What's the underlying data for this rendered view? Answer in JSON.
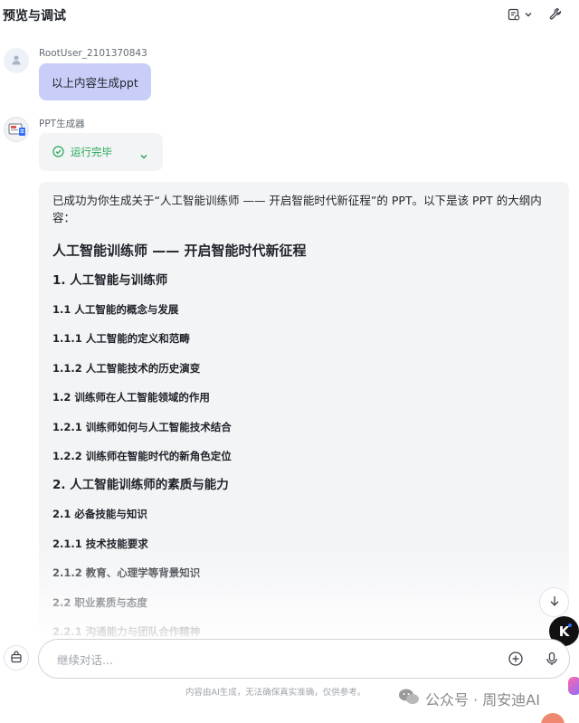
{
  "header": {
    "title": "预览与调试"
  },
  "user_message": {
    "sender": "RootUser_2101370843",
    "text": "以上内容生成ppt"
  },
  "bot_message": {
    "sender": "PPT生成器",
    "run_status": "运行完毕",
    "intro": "已成功为你生成关于“人工智能训练师 —— 开启智能时代新征程”的 PPT。以下是该 PPT 的大纲内容：",
    "outline_title": "人工智能训练师 —— 开启智能时代新征程",
    "outline": [
      {
        "level": 2,
        "text": "1. 人工智能与训练师"
      },
      {
        "level": 3,
        "text": "1.1 人工智能的概念与发展"
      },
      {
        "level": 3,
        "text": "1.1.1 人工智能的定义和范畴"
      },
      {
        "level": 3,
        "text": "1.1.2 人工智能技术的历史演变"
      },
      {
        "level": 3,
        "text": "1.2 训练师在人工智能领域的作用"
      },
      {
        "level": 3,
        "text": "1.2.1 训练师如何与人工智能技术结合"
      },
      {
        "level": 3,
        "text": "1.2.2 训练师在智能时代的新角色定位"
      },
      {
        "level": 2,
        "text": "2. 人工智能训练师的素质与能力"
      },
      {
        "level": 3,
        "text": "2.1 必备技能与知识"
      },
      {
        "level": 3,
        "text": "2.1.1 技术技能要求"
      },
      {
        "level": 3,
        "text": "2.1.2 教育、心理学等背景知识"
      },
      {
        "level": 3,
        "text": "2.2 职业素质与态度"
      },
      {
        "level": 3,
        "text": "2.2.1 沟通能力与团队合作精神"
      }
    ]
  },
  "composer": {
    "placeholder": "继续对话..."
  },
  "footer": {
    "disclaimer": "内容由AI生成，无法确保真实准确，仅供参考。",
    "watermark": "公众号 · 周安迪AI",
    "k_logo": "K"
  },
  "colors": {
    "user_bubble": "#c9cef9",
    "success": "#22a855",
    "panel_bg": "#f3f4f6"
  },
  "icons": {
    "header": [
      "document-settings-icon",
      "chevron-down-icon",
      "wrench-icon"
    ],
    "composer": [
      "plugin-icon",
      "add-circle-icon",
      "microphone-icon"
    ],
    "other": [
      "user-avatar-icon",
      "bot-avatar-icon",
      "check-circle-icon",
      "arrow-down-icon"
    ]
  }
}
